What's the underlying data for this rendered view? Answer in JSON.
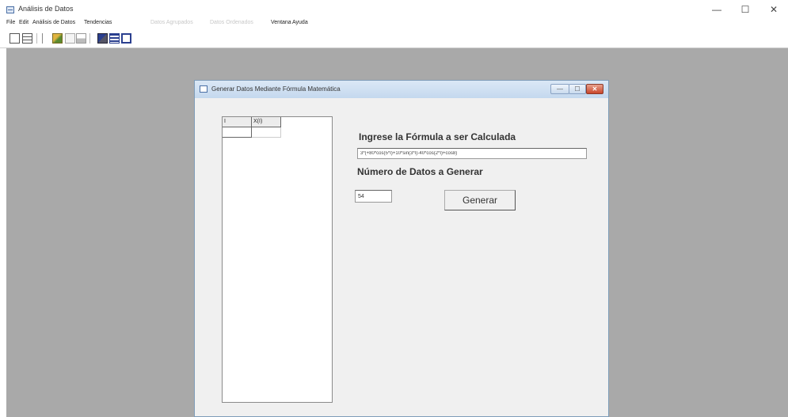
{
  "app": {
    "title": "Análisis de Datos",
    "window_controls": [
      "—",
      "☐",
      "✕"
    ]
  },
  "menubar": {
    "items": [
      {
        "label": "File",
        "enabled": true
      },
      {
        "label": "Edit",
        "enabled": true
      },
      {
        "label": "Análisis de Datos",
        "enabled": true
      },
      {
        "label": "Tendencias",
        "enabled": true
      },
      {
        "label": "Datos Agrupados",
        "enabled": false
      },
      {
        "label": "Datos Ordenados",
        "enabled": false
      },
      {
        "label": "Ventana",
        "enabled": true
      },
      {
        "label": "Ayuda",
        "enabled": true
      }
    ]
  },
  "toolbar": {
    "buttons": [
      "new-document-icon",
      "grid-icon",
      "open-folder-icon",
      "chart-icon",
      "table-icon",
      "settings-icon",
      "list-icon",
      "window-icon"
    ]
  },
  "dialog": {
    "title": "Generar Datos Mediante Fórmula Matemática",
    "buttons": [
      "—",
      "☐",
      "✕"
    ],
    "grid": {
      "headers": [
        "I",
        "X(I)"
      ]
    },
    "formula_label": "Ingrese la Fórmula a ser Calculada",
    "formula_value": "3*(+80*cos(5*I)+10*sin(3*I)-40*cos(2*I)+cos8)",
    "count_label": "Número de Datos a Generar",
    "count_value": "54",
    "generate_label": "Generar"
  },
  "colors": {
    "mdi_background": "#a9a9a9",
    "dialog_background": "#f0f0f0",
    "title_gradient": "#c4d8ee",
    "close_button": "#c9452b"
  }
}
